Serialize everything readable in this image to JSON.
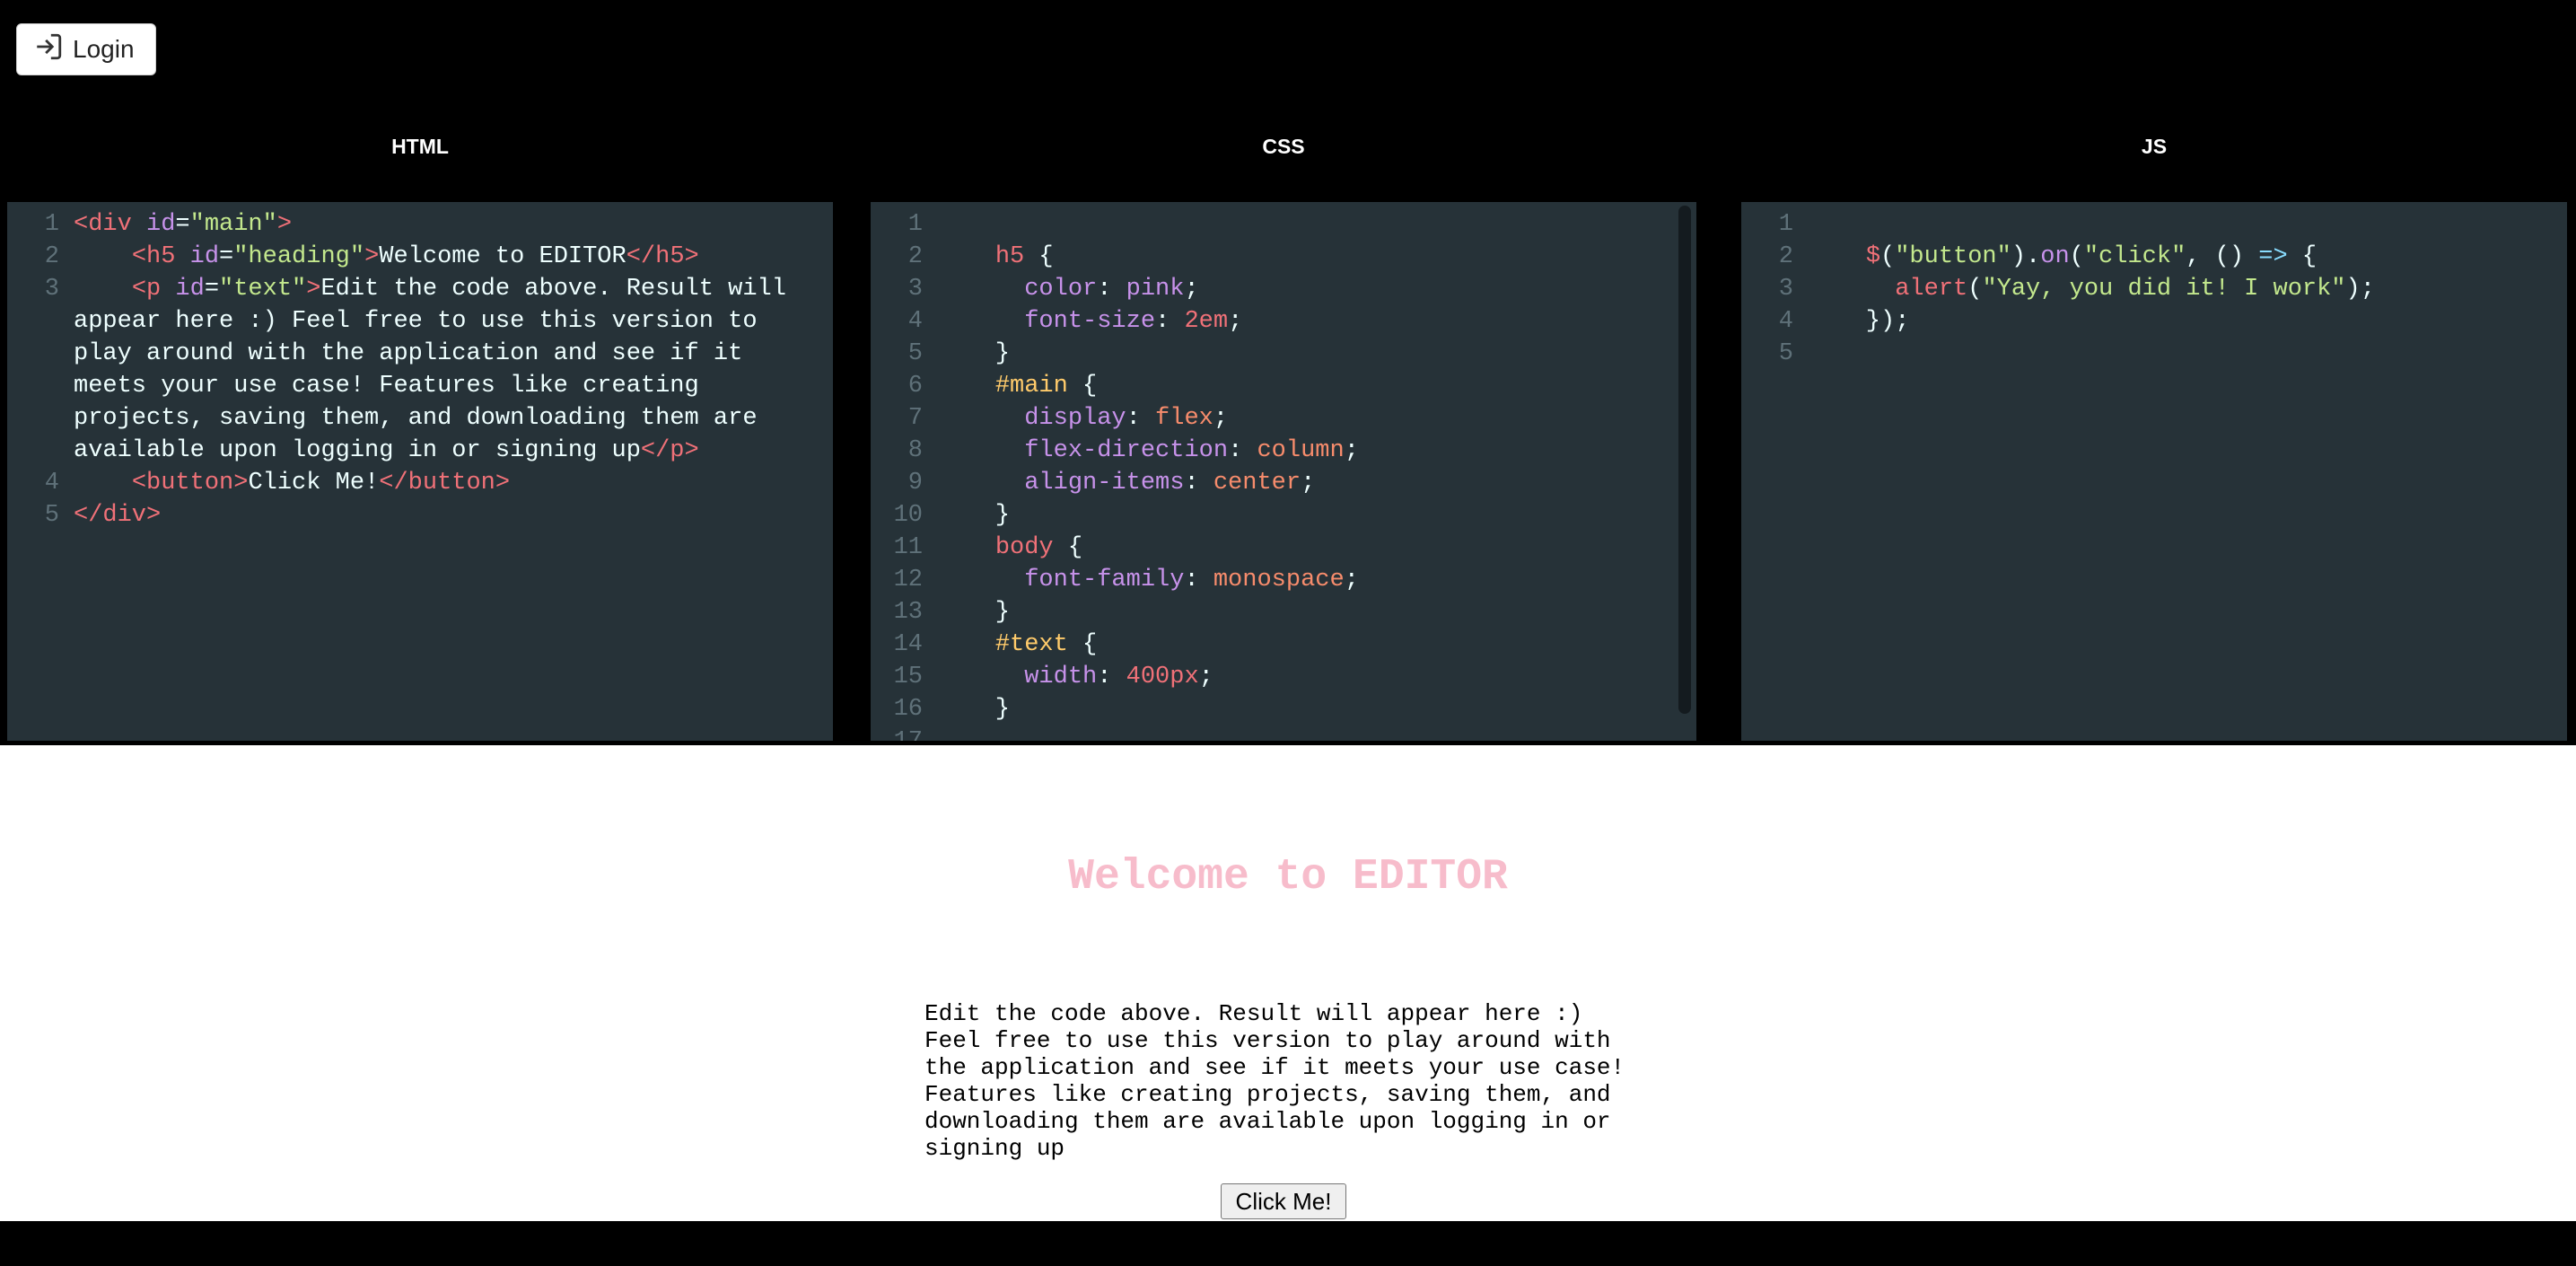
{
  "header": {
    "login_label": "Login"
  },
  "panes": {
    "html": "HTML",
    "css": "CSS",
    "js": "JS"
  },
  "html_editor": {
    "l1_open": "<div",
    "l1_attr": " id",
    "l1_eq": "=",
    "l1_str": "\"main\"",
    "l1_close": ">",
    "l2_open": "<h5",
    "l2_attr": " id",
    "l2_eq": "=",
    "l2_str": "\"heading\"",
    "l2_close": ">",
    "l2_text": "Welcome to EDITOR",
    "l2_end": "</h5>",
    "l3_open": "<p",
    "l3_attr": " id",
    "l3_eq": "=",
    "l3_str": "\"text\"",
    "l3_close": ">",
    "l3_text": "Edit the code above. Result will appear here :) Feel free to use this version to play around with the application and see if it meets your use case! Features like creating projects, saving them, and downloading them are available upon logging in or signing up",
    "l3_end": "</p>",
    "l4_open": "<button>",
    "l4_text": "Click Me!",
    "l4_end": "</button>",
    "l5_end": "</div>"
  },
  "css_editor": {
    "h5_sel": "h5",
    "color_prop": "color",
    "color_val": "pink",
    "fs_prop": "font-size",
    "fs_val": "2em",
    "main_sel": "#main",
    "display_prop": "display",
    "display_val": "flex",
    "fd_prop": "flex-direction",
    "fd_val": "column",
    "ai_prop": "align-items",
    "ai_val": "center",
    "body_sel": "body",
    "ff_prop": "font-family",
    "ff_val": "monospace",
    "text_sel": "#text",
    "w_prop": "width",
    "w_val": "400px"
  },
  "js_editor": {
    "dollar": "$",
    "sel_str": "\"button\"",
    "on": "on",
    "click_str": "\"click\"",
    "arrow": "=>",
    "alert": "alert",
    "msg_str": "\"Yay, you did it! I work\""
  },
  "result": {
    "heading": "Welcome to EDITOR",
    "text": "Edit the code above. Result will appear here :) Feel free to use this version to play around with the application and see if it meets your use case! Features like creating projects, saving them, and downloading them are available upon logging in or signing up",
    "button": "Click Me!"
  },
  "colors": {
    "editor_bg": "#263238",
    "tag": "#f07178",
    "attr": "#c792ea",
    "string": "#c3e88d",
    "selector": "#ffcb6b",
    "value": "#f78c6c",
    "heading_pink": "#f7bccb"
  },
  "icons": {
    "login": "login-arrow-icon"
  }
}
